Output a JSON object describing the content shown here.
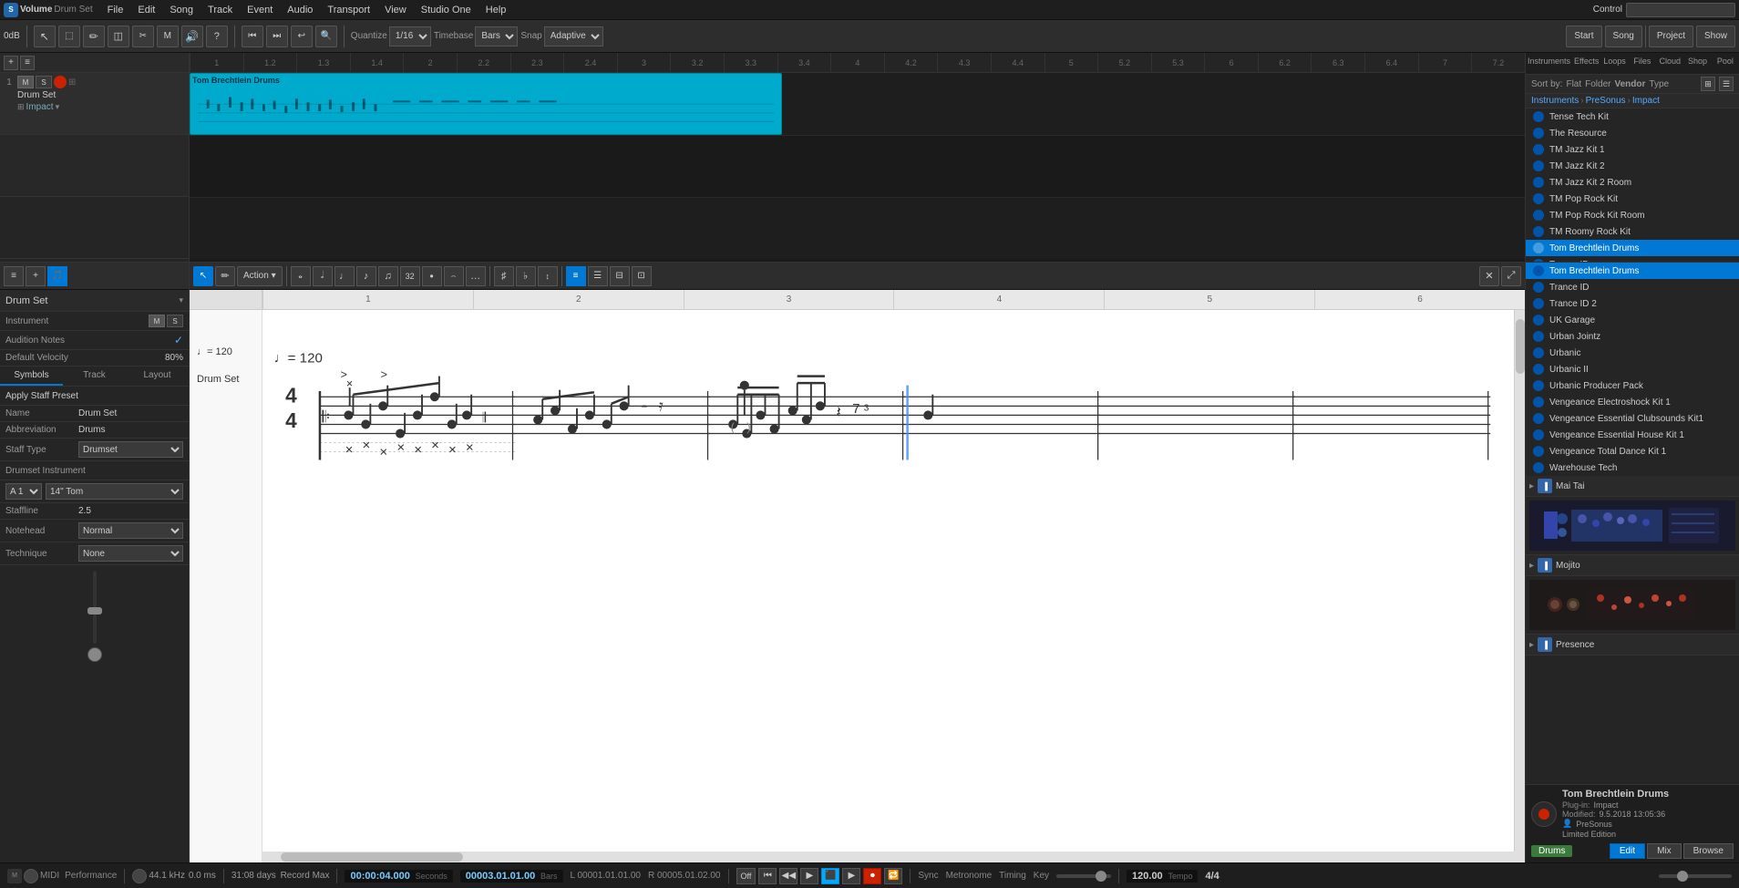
{
  "app": {
    "title": "Studio One",
    "volume_label": "Volume",
    "track_name": "Drum Set",
    "volume_val": "0dB",
    "control_label": "Control"
  },
  "menu": {
    "items": [
      "File",
      "Edit",
      "Song",
      "Track",
      "Event",
      "Audio",
      "Transport",
      "View",
      "Studio One",
      "Help"
    ]
  },
  "toolbar": {
    "quantize_label": "Quantize",
    "quantize_val": "1/16",
    "timebase_label": "Timebase",
    "timebase_val": "Bars",
    "snap_label": "Snap",
    "snap_val": "Adaptive",
    "start_label": "Start",
    "song_label": "Song",
    "project_label": "Project",
    "show_label": "Show"
  },
  "browser_tabs": [
    "Instruments",
    "Effects",
    "Loops",
    "Files",
    "Cloud",
    "Shop",
    "Pool"
  ],
  "sort_options": [
    "Sort by:",
    "Flat",
    "Folder",
    "Vendor",
    "Type"
  ],
  "breadcrumbs": [
    "Instruments",
    "PreSonus",
    "Impact"
  ],
  "browser_items": [
    "Tense Tech Kit",
    "The Resource",
    "TM Jazz Kit 1",
    "TM Jazz Kit 2",
    "TM Jazz Kit 2 Room",
    "TM Pop Rock Kit",
    "TM Pop Rock Kit Room",
    "TM Roomy Rock Kit",
    "Tom Brechtlein Drums",
    "Trance ID",
    "Trance ID 2",
    "UK Garage",
    "Urban Jointz",
    "Urbanic",
    "Urbanic II",
    "Urbanic Producer Pack",
    "Vengeance Electroshock Kit 1",
    "Vengeance Essential Clubsounds Kit1",
    "Vengeance Essential House Kit 1",
    "Vengeance Total Dance Kit 1",
    "Warehouse Tech"
  ],
  "browser_sections": [
    "Mai Tai",
    "Mojito",
    "Presence"
  ],
  "bottom_badge": "Drums",
  "bottom_title": "Tom Brechtlein Drums",
  "bottom_plugin": "Impact",
  "bottom_modified": "9.5.2018 13:05:36",
  "bottom_vendor": "PreSonus",
  "bottom_edition": "Limited Edition",
  "bottom_actions": [
    "Edit",
    "Mix",
    "Browse"
  ],
  "drum_editor": {
    "title": "Drum Set",
    "instrument_label": "Instrument",
    "instrument_m": "M",
    "instrument_s": "S",
    "audition_notes_label": "Audition Notes",
    "default_velocity_label": "Default Velocity",
    "default_velocity_val": "80%",
    "tabs": [
      "Symbols",
      "Track",
      "Layout"
    ],
    "apply_staff_preset": "Apply Staff Preset",
    "name_label": "Name",
    "name_val": "Drum Set",
    "abbreviation_label": "Abbreviation",
    "abbreviation_val": "Drums",
    "staff_type_label": "Staff Type",
    "staff_type_val": "Drumset",
    "drumset_instrument_label": "Drumset Instrument",
    "a1_label": "A 1",
    "a1_val": "14\" Tom",
    "staffline_label": "Staffline",
    "staffline_val": "2.5",
    "notehead_label": "Notehead",
    "notehead_val": "Normal",
    "technique_label": "Technique",
    "technique_val": "None"
  },
  "track": {
    "num": "1",
    "m_btn": "M",
    "s_btn": "S",
    "name": "Drum Set",
    "instrument": "Impact",
    "clip_label": "Tom Brechtlein Drums"
  },
  "score": {
    "tempo": "♩= 120",
    "time_sig_num": "4",
    "time_sig_den": "4",
    "instrument_name": "Drum Set",
    "measures": [
      "1",
      "2",
      "3",
      "4",
      "5",
      "6"
    ],
    "cursor_position": "3"
  },
  "status_bar": {
    "midi": "MIDI",
    "performance": "Performance",
    "sample_rate": "44.1 kHz",
    "latency": "0.0 ms",
    "record_max": "31:08 days",
    "record_label": "Record Max",
    "time": "00:00:04.000",
    "time_label": "Seconds",
    "position": "00003.01.01.00",
    "position_label": "Bars",
    "L_pos": "L 00001.01.01.00",
    "R_pos": "R 00005.01.02.00",
    "sync": "Off",
    "sync_label": "Sync",
    "metronome_label": "Metronome",
    "timing_label": "Timing",
    "key_label": "Key",
    "tempo_val": "120.00",
    "tempo_label": "Tempo",
    "time_sig": "4/4",
    "time_sig_label": "Key"
  },
  "ruler_marks": [
    "1",
    "1.2",
    "1.3",
    "1.4",
    "2",
    "2.2",
    "2.3",
    "2.4",
    "3",
    "3.2",
    "3.3",
    "3.4",
    "4",
    "4.2",
    "4.3",
    "4.4",
    "5",
    "5.2",
    "5.3",
    "6",
    "6.2",
    "6.3",
    "6.4",
    "7",
    "7.2"
  ]
}
